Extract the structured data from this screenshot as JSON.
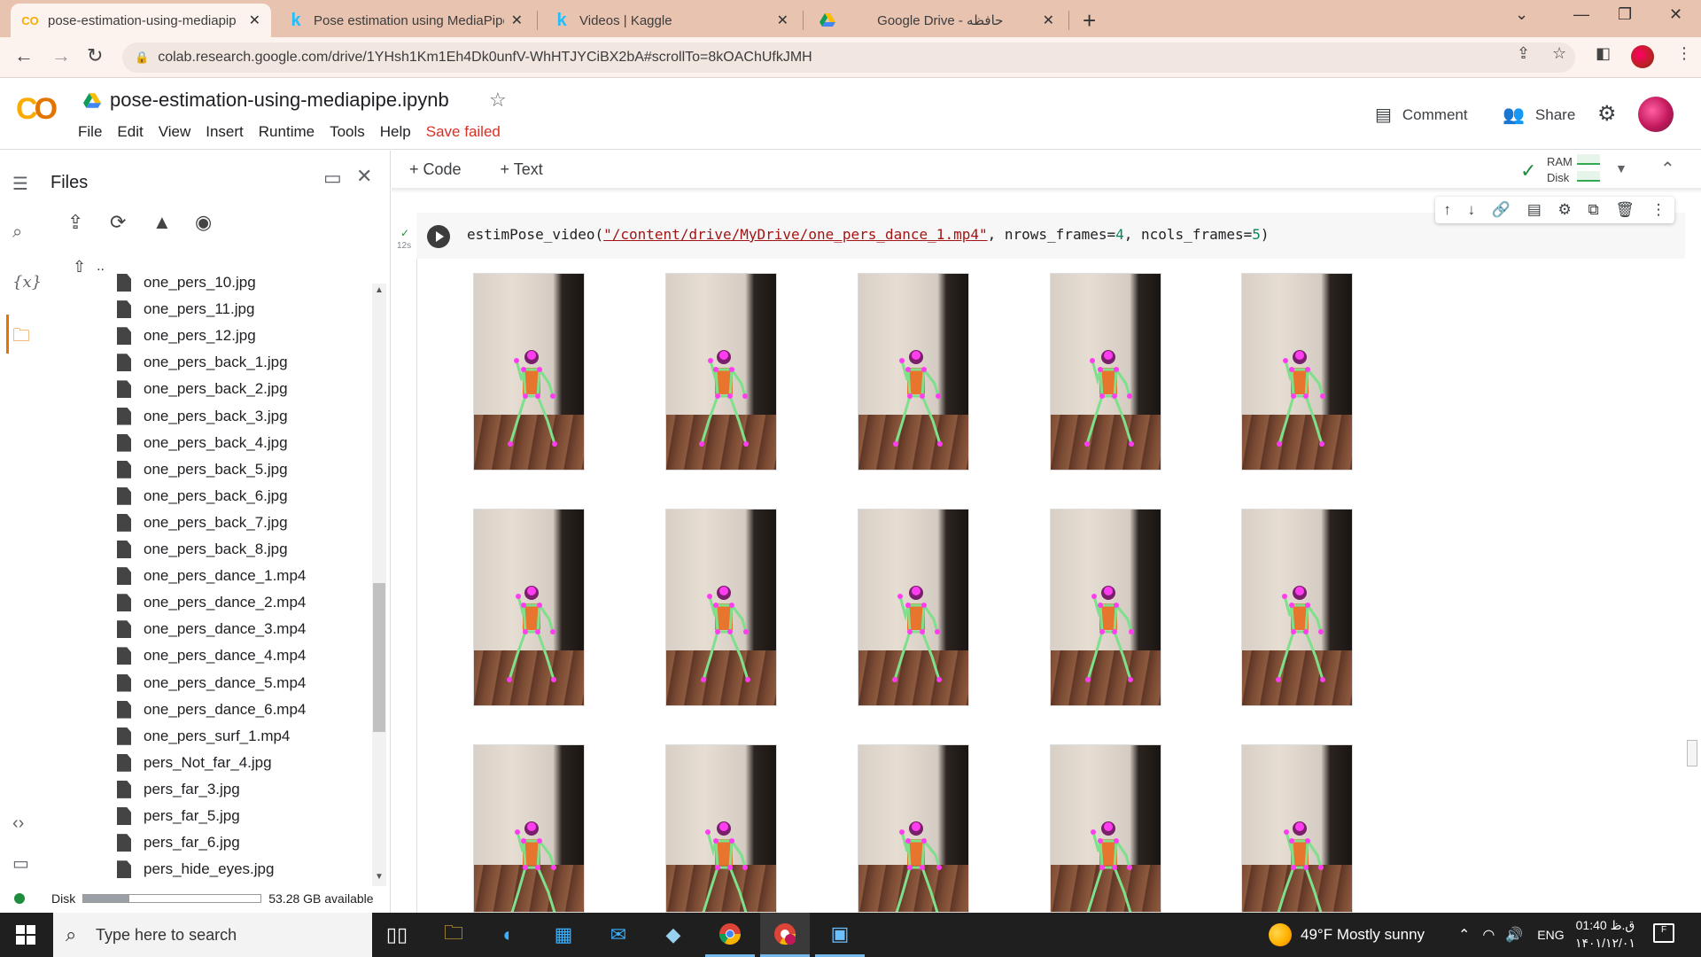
{
  "browser": {
    "tabs": [
      {
        "title": "pose-estimation-using-mediapip",
        "icon": "colab-icon",
        "active": true
      },
      {
        "title": "Pose estimation using MediaPipe",
        "icon": "kaggle-icon"
      },
      {
        "title": "Videos | Kaggle",
        "icon": "kaggle-icon"
      },
      {
        "title": "Google Drive - حافظه",
        "icon": "drive-icon"
      }
    ],
    "url": "colab.research.google.com/drive/1YHsh1Km1Eh4Dk0unfV-WhHTJYCiBX2bA#scrollTo=8kOAChUfkJMH"
  },
  "colab": {
    "notebook_title": "pose-estimation-using-mediapipe.ipynb",
    "menu": [
      "File",
      "Edit",
      "View",
      "Insert",
      "Runtime",
      "Tools",
      "Help"
    ],
    "save_status": "Save failed",
    "comment_label": "Comment",
    "share_label": "Share"
  },
  "files_panel": {
    "title": "Files",
    "parent_dir": "..",
    "files": [
      "one_pers_10.jpg",
      "one_pers_11.jpg",
      "one_pers_12.jpg",
      "one_pers_back_1.jpg",
      "one_pers_back_2.jpg",
      "one_pers_back_3.jpg",
      "one_pers_back_4.jpg",
      "one_pers_back_5.jpg",
      "one_pers_back_6.jpg",
      "one_pers_back_7.jpg",
      "one_pers_back_8.jpg",
      "one_pers_dance_1.mp4",
      "one_pers_dance_2.mp4",
      "one_pers_dance_3.mp4",
      "one_pers_dance_4.mp4",
      "one_pers_dance_5.mp4",
      "one_pers_dance_6.mp4",
      "one_pers_surf_1.mp4",
      "pers_Not_far_4.jpg",
      "pers_far_3.jpg",
      "pers_far_5.jpg",
      "pers_far_6.jpg",
      "pers_hide_eyes.jpg"
    ],
    "disk_label": "Disk",
    "disk_available": "53.28 GB available",
    "disk_used_fraction": 0.26
  },
  "notebook": {
    "add_code": "Code",
    "add_text": "Text",
    "ram_label": "RAM",
    "disk_label": "Disk",
    "cell": {
      "exec_time": "12s",
      "code_fn": "estimPose_video(",
      "code_path": "\"/content/drive/MyDrive/one_pers_dance_1.mp4\"",
      "code_arg1": ", nrows_frames=",
      "code_val1": "4",
      "code_arg2": ", ncols_frames=",
      "code_val2": "5",
      "code_end": ")"
    },
    "output": {
      "rows_visible": 3,
      "cols": 5
    }
  },
  "taskbar": {
    "search_placeholder": "Type here to search",
    "weather": "49°F  Mostly sunny",
    "language": "ENG",
    "time": "01:40 ق.ظ",
    "date": "۱۴۰۱/۱۲/۰۱",
    "notification_count": "F"
  }
}
